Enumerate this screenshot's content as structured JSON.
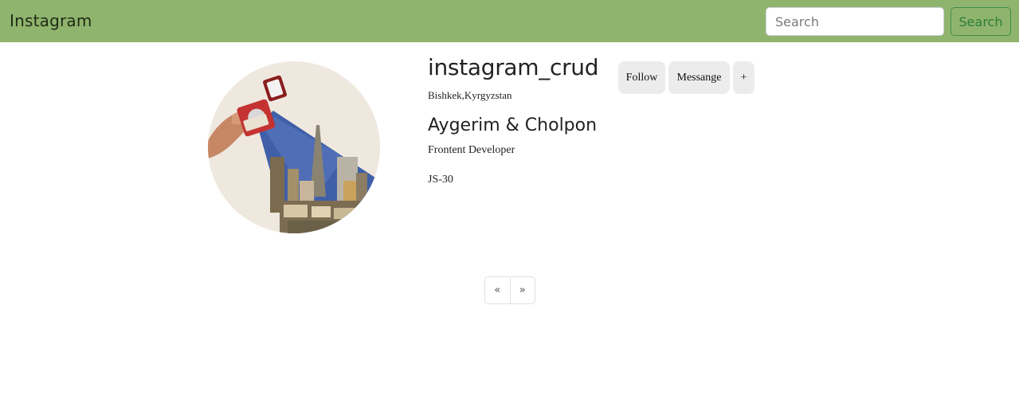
{
  "navbar": {
    "brand": "Instagram",
    "search": {
      "placeholder": "Search",
      "value": ""
    },
    "search_button_label": "Search"
  },
  "profile": {
    "username": "instagram_crud",
    "location": "Bishkek,Kyrgyzstan",
    "full_name": "Aygerim & Cholpon",
    "bio": "Frontent Developer",
    "tag": "JS-30",
    "actions": {
      "follow_label": "Follow",
      "message_label": "Messange",
      "plus_label": "+"
    }
  },
  "pagination": {
    "prev_label": "«",
    "next_label": "»"
  },
  "colors": {
    "navbar_bg": "#8fb46e",
    "search_button": "#2e7d3a",
    "action_button_bg": "#ececec"
  },
  "icons": {
    "avatar": "profile-photo-collage"
  }
}
